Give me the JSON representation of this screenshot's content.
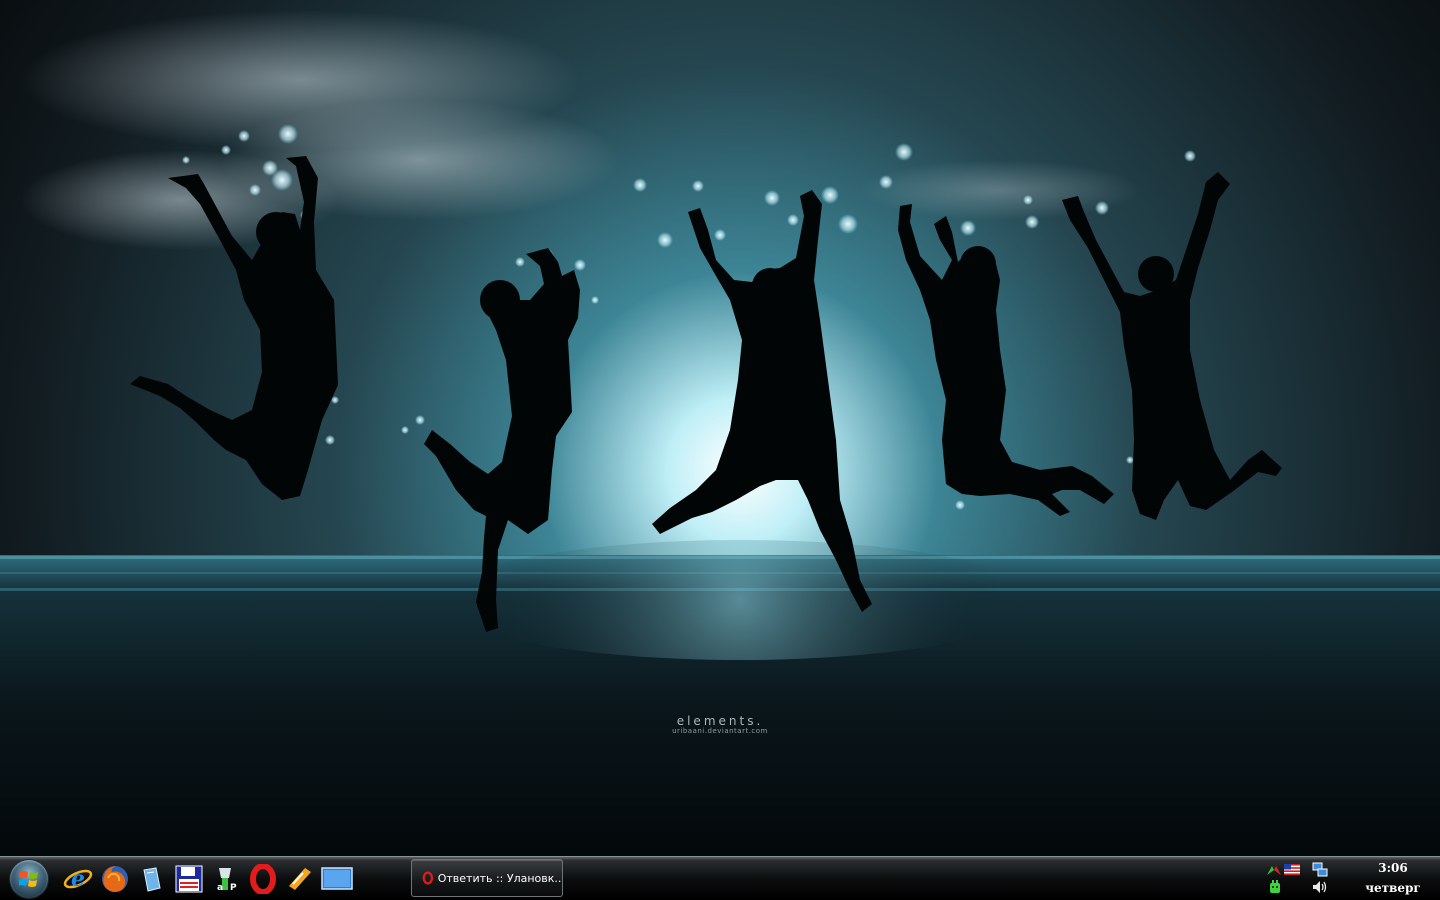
{
  "wallpaper": {
    "watermark_title": "elements.",
    "watermark_sub": "uribaani.deviantart.com"
  },
  "taskbar": {
    "start_icon": "windows-logo-icon",
    "quick_launch": [
      {
        "name": "internet-explorer-icon"
      },
      {
        "name": "firefox-icon"
      },
      {
        "name": "documents-icon"
      },
      {
        "name": "save-disk-icon"
      },
      {
        "name": "aimp-player-icon"
      },
      {
        "name": "opera-icon"
      },
      {
        "name": "winamp-icon"
      },
      {
        "name": "show-desktop-icon"
      }
    ],
    "tasks": [
      {
        "label": "Ответить :: Улановк...",
        "icon": "opera-icon"
      }
    ],
    "tray_icons": [
      "network-arrows-icon",
      "language-flag-icon",
      "network-monitor-icon",
      "antivirus-icon",
      "volume-icon"
    ]
  },
  "clock": {
    "time": "3:06",
    "day": "четверг"
  },
  "colors": {
    "sky": "#3b5966",
    "glow": "#e8fbff",
    "ground": "#0b171c"
  }
}
